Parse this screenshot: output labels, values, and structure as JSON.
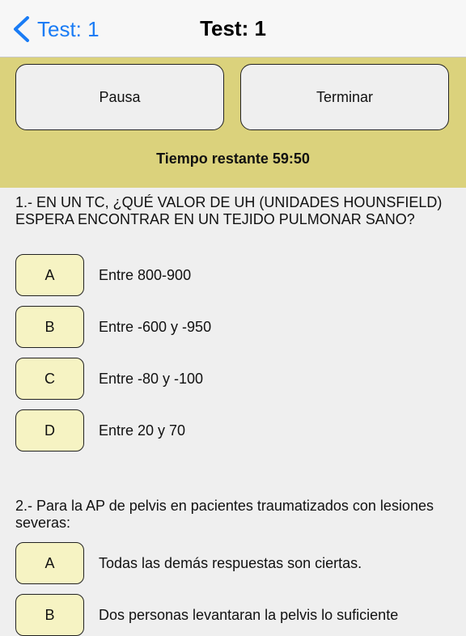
{
  "nav": {
    "back_label": "Test: 1",
    "title": "Test: 1"
  },
  "controls": {
    "pause_label": "Pausa",
    "finish_label": "Terminar",
    "timer_text": "Tiempo restante 59:50"
  },
  "questions": [
    {
      "text": "1.- EN UN TC, ¿QUÉ VALOR DE UH (UNIDADES HOUNSFIELD) ESPERA ENCONTRAR EN UN TEJIDO PULMONAR SANO?",
      "options": [
        {
          "letter": "A",
          "text": "Entre 800-900"
        },
        {
          "letter": "B",
          "text": "Entre -600 y -950"
        },
        {
          "letter": "C",
          "text": "Entre -80 y -100"
        },
        {
          "letter": "D",
          "text": "Entre 20 y 70"
        }
      ]
    },
    {
      "text": "2.- Para la AP de pelvis en pacientes traumatizados con lesiones severas:",
      "options": [
        {
          "letter": "A",
          "text": "Todas las demás respuestas son ciertas."
        },
        {
          "letter": "B",
          "text": "Dos personas levantaran la pelvis lo suficiente"
        }
      ]
    }
  ],
  "colors": {
    "accent": "#1a7cf5",
    "panel": "#dbd27c",
    "option_fill": "#f6f3c3"
  }
}
